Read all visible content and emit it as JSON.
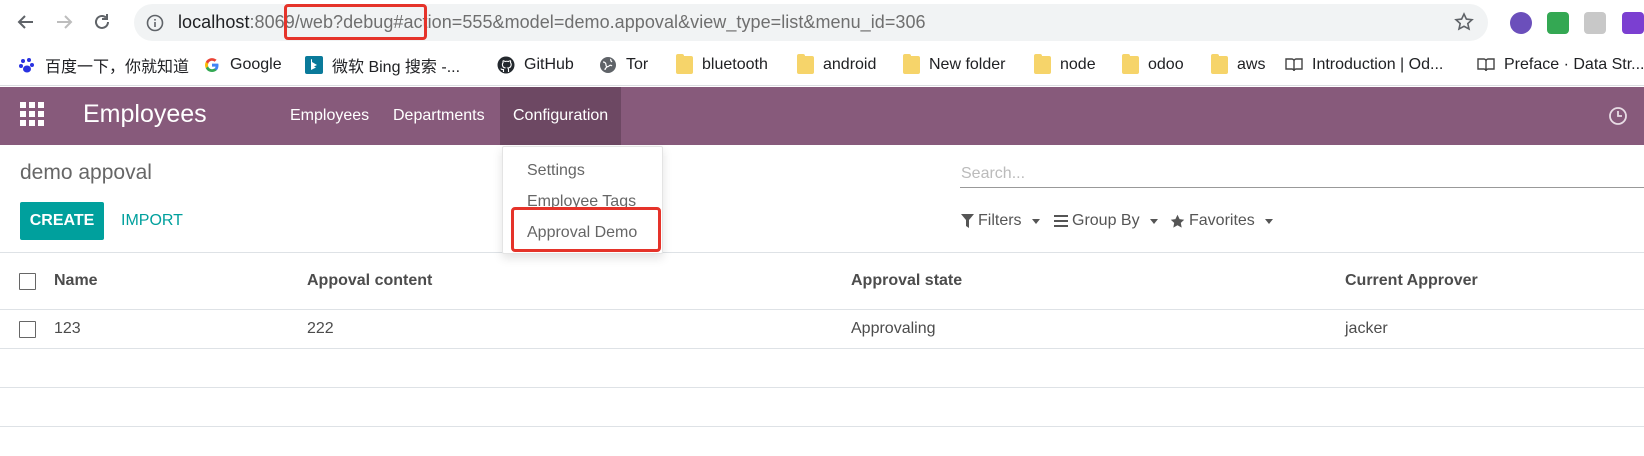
{
  "browser": {
    "url": {
      "host": "localhost",
      "port_path": ":8069/web?debug#action=555&model=demo.appoval&view_type=list&menu_id=306"
    },
    "bookmarks": [
      {
        "label": "百度一下，你就知道",
        "icon": "baidu-icon"
      },
      {
        "label": "Google",
        "icon": "google-icon"
      },
      {
        "label": "微软 Bing 搜索 -...",
        "icon": "bing-icon"
      },
      {
        "label": "GitHub",
        "icon": "github-icon"
      },
      {
        "label": "Tor",
        "icon": "globe-icon"
      },
      {
        "label": "bluetooth",
        "icon": "folder-icon"
      },
      {
        "label": "android",
        "icon": "folder-icon"
      },
      {
        "label": "New folder",
        "icon": "folder-icon"
      },
      {
        "label": "node",
        "icon": "folder-icon"
      },
      {
        "label": "odoo",
        "icon": "folder-icon"
      },
      {
        "label": "aws",
        "icon": "folder-icon"
      },
      {
        "label": "Introduction | Od...",
        "icon": "book-icon"
      },
      {
        "label": "Preface · Data Str...",
        "icon": "book-icon"
      }
    ]
  },
  "app": {
    "brand": "Employees",
    "menu": [
      "Employees",
      "Departments",
      "Configuration"
    ],
    "active_menu": "Configuration",
    "colors": {
      "navbar": "#875a7b",
      "primary": "#00a09d",
      "highlight": "#e5332a"
    }
  },
  "dropdown": {
    "items": [
      "Settings",
      "Employee Tags",
      "Approval Demo"
    ]
  },
  "control_panel": {
    "breadcrumb": "demo appoval",
    "create_label": "CREATE",
    "import_label": "IMPORT",
    "search_placeholder": "Search...",
    "filters_label": "Filters",
    "groupby_label": "Group By",
    "favorites_label": "Favorites"
  },
  "list": {
    "columns": [
      "Name",
      "Appoval content",
      "Approval state",
      "Current Approver"
    ],
    "rows": [
      {
        "name": "123",
        "content": "222",
        "state": "Approvaling",
        "approver": "jacker"
      }
    ]
  }
}
